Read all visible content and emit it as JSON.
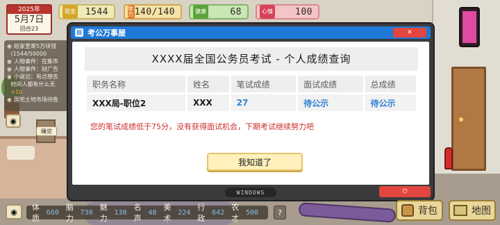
{
  "calendar": {
    "year": "2025年",
    "date": "5月7日",
    "round": "回合23"
  },
  "hud": {
    "money": {
      "icon_label": "现金",
      "value": "1544"
    },
    "stamina": {
      "icon_label": "体力",
      "value": "140/140"
    },
    "health": {
      "icon_label": "健康",
      "value": "68"
    },
    "mood": {
      "icon_label": "心情",
      "value": "100"
    }
  },
  "event_log": [
    {
      "text": "给家里寄5万块钱",
      "highlight": ""
    },
    {
      "text": "(1544/50000",
      "highlight": ""
    },
    {
      "text": "人物事件：在集市",
      "highlight": ""
    },
    {
      "text": "人物事件：财广告",
      "highlight": ""
    },
    {
      "text": "小说记：有点想去",
      "highlight": ""
    },
    {
      "text": "时间人都有什么无",
      "highlight": ""
    },
    {
      "text": "",
      "highlight": "+10"
    },
    {
      "text": "国宅土地市场待售",
      "highlight": ""
    }
  ],
  "sleep_label": "睡觉",
  "popup": {
    "title": "考公万事屋",
    "app_icon_text": "回",
    "close_symbol": "✕",
    "results_title": "XXXX届全国公务员考试 - 个人成绩查询",
    "table": {
      "headers": [
        "职务名称",
        "姓名",
        "笔试成绩",
        "面试成绩",
        "总成绩"
      ],
      "row": [
        "XXX局-职位2",
        "XXX",
        "27",
        "待公示",
        "待公示"
      ]
    },
    "message": "您的笔试成绩低于75分，没有获得面试机会，下期考试继续努力吧",
    "ack_button": "我知道了",
    "taskbar_label": "WINDOWS",
    "power_symbol": "⏻"
  },
  "stats": [
    {
      "label": "体质",
      "value": "660"
    },
    {
      "label": "脑力",
      "value": "730"
    },
    {
      "label": "魅力",
      "value": "130"
    },
    {
      "label": "名声",
      "value": "48"
    },
    {
      "label": "美术",
      "value": "224"
    },
    {
      "label": "行政",
      "value": "642"
    },
    {
      "label": "农才",
      "value": "500"
    }
  ],
  "help_label": "?",
  "bag_label": "背包",
  "map_label": "地图",
  "colors": {
    "titlebar": "#1f79d6",
    "close": "#e2463e",
    "score_blue": "#2f7fd3",
    "warning_red": "#cc2c2c",
    "button_yellow": "#fff0bc"
  },
  "icons": [
    "eye-icon",
    "close-icon",
    "power-icon",
    "bag-icon",
    "map-icon",
    "phone-icon",
    "help-icon"
  ]
}
